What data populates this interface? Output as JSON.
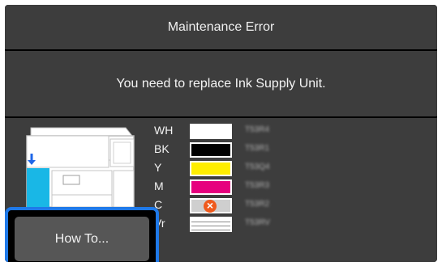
{
  "header": {
    "title": "Maintenance Error"
  },
  "message": {
    "text": "You need to replace Ink Supply Unit."
  },
  "inks": [
    {
      "label": "WH",
      "color": "#ffffff",
      "code": "T53R4",
      "state": "ok"
    },
    {
      "label": "BK",
      "color": "#000000",
      "code": "T53R1",
      "state": "ok"
    },
    {
      "label": "Y",
      "color": "#ffee00",
      "code": "T53Q4",
      "state": "ok"
    },
    {
      "label": "M",
      "color": "#e6007e",
      "code": "T53R3",
      "state": "ok"
    },
    {
      "label": "C",
      "color": "#cfcfcf",
      "code": "T53R2",
      "state": "error"
    },
    {
      "label": "Vr",
      "color": "#ffffff",
      "code": "T53RV",
      "state": "ok"
    }
  ],
  "actions": {
    "how_to_label": "How To..."
  },
  "colors": {
    "background": "#3d3d3d",
    "highlight": "#1f79e8",
    "button": "#565656",
    "error": "#ef5a1d",
    "printer_ink": "#19b7e6"
  },
  "icons": {
    "printer": "printer-illustration",
    "arrow": "down-arrow-icon",
    "error": "error-x-icon"
  }
}
